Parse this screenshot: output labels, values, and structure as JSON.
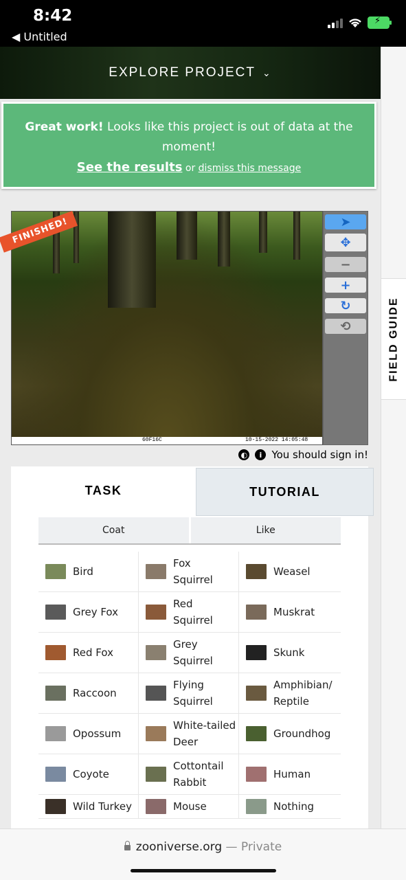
{
  "status": {
    "time": "8:42",
    "back_label": "◀ Untitled"
  },
  "header": {
    "title": "EXPLORE PROJECT",
    "chevron": "⌄"
  },
  "banner": {
    "strong": "Great work!",
    "text": " Looks like this project is out of data at the moment!",
    "results_link": "See the results",
    "or": " or ",
    "dismiss_link": "dismiss this message"
  },
  "subject": {
    "ribbon": "FINISHED!",
    "strip_code": "60F16C",
    "strip_date": "10-15-2022 14:05:48"
  },
  "toolbar": {
    "tools": [
      {
        "name": "pointer-tool",
        "icon": "➤"
      },
      {
        "name": "move-tool",
        "icon": "✥"
      },
      {
        "name": "zoom-out-tool",
        "icon": "−"
      },
      {
        "name": "zoom-in-tool",
        "icon": "+"
      },
      {
        "name": "rotate-tool",
        "icon": "↻"
      },
      {
        "name": "reset-tool",
        "icon": "⟲"
      }
    ]
  },
  "signin": {
    "contrast_icon": "◐",
    "info_icon": "i",
    "text": "You should sign in!"
  },
  "field_guide": {
    "label": "FIELD GUIDE"
  },
  "tabs": {
    "task": "TASK",
    "tutorial": "TUTORIAL"
  },
  "filters": {
    "coat": "Coat",
    "like": "Like"
  },
  "species": [
    [
      "Bird",
      "Fox\nSquirrel",
      "Weasel"
    ],
    [
      "Grey Fox",
      "Red\nSquirrel",
      "Muskrat"
    ],
    [
      "Red Fox",
      "Grey\nSquirrel",
      "Skunk"
    ],
    [
      "Raccoon",
      "Flying\nSquirrel",
      "Amphibian/\nReptile"
    ],
    [
      "Opossum",
      "White-tailed\nDeer",
      "Groundhog"
    ],
    [
      "Coyote",
      "Cottontail\nRabbit",
      "Human"
    ],
    [
      "Wild Turkey",
      "Mouse",
      "Nothing"
    ]
  ],
  "thumb_colors": [
    [
      "#7a8a5a",
      "#8a7a6a",
      "#5a4a30"
    ],
    [
      "#5a5a5a",
      "#8a5a3a",
      "#7a6a5a"
    ],
    [
      "#a05a30",
      "#8a8070",
      "#222"
    ],
    [
      "#6a7060",
      "#555",
      "#6a5a40"
    ],
    [
      "#9a9a9a",
      "#9a7a5a",
      "#4a6030"
    ],
    [
      "#7a8aa0",
      "#6a7050",
      "#a07070"
    ],
    [
      "#3a3028",
      "#8a6a6a",
      "#8a9a8a"
    ]
  ],
  "browser": {
    "domain": "zooniverse.org",
    "suffix": " — Private"
  }
}
